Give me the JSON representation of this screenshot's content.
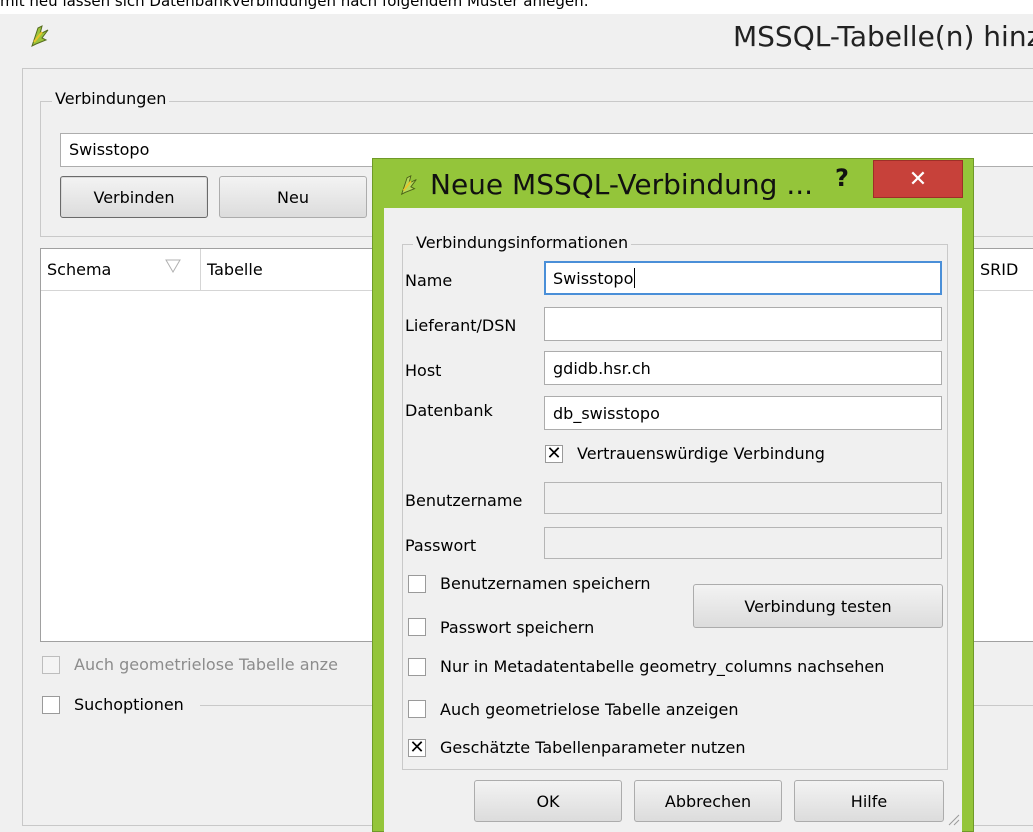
{
  "page_intro": "mit neu lassen sich Datenbankverbindungen nach folgendem Muster anlegen:",
  "main_window": {
    "title": "MSSQL-Tabelle(n) hinz",
    "connections_group_title": "Verbindungen",
    "selected_connection": "Swisstopo",
    "connect_label": "Verbinden",
    "new_label": "Neu",
    "table_headers": {
      "schema": "Schema",
      "table": "Tabelle",
      "srid": "SRID"
    },
    "show_nogeom_label": "Auch geometrielose Tabelle anze",
    "search_options_label": "Suchoptionen"
  },
  "dialog": {
    "title": "Neue MSSQL-Verbindung ...",
    "help_glyph": "?",
    "close_glyph": "✕",
    "group_title": "Verbindungsinformationen",
    "fields": {
      "name_label": "Name",
      "name_value": "Swisstopo",
      "provider_label": "Lieferant/DSN",
      "provider_value": "",
      "host_label": "Host",
      "host_value": "gdidb.hsr.ch",
      "database_label": "Datenbank",
      "database_value": "db_swisstopo",
      "username_label": "Benutzername",
      "username_value": "",
      "password_label": "Passwort",
      "password_value": ""
    },
    "trusted_label": "Vertrauenswürdige Verbindung",
    "trusted_checked": true,
    "save_username_label": "Benutzernamen speichern",
    "save_password_label": "Passwort speichern",
    "test_connection_label": "Verbindung testen",
    "only_metadata_label": "Nur in Metadatentabelle geometry_columns nachsehen",
    "show_nogeom_label": "Auch geometrielose Tabelle anzeigen",
    "estimated_params_label": "Geschätzte Tabellenparameter nutzen",
    "estimated_params_checked": true,
    "check_mark": "✕",
    "ok_label": "OK",
    "cancel_label": "Abbrechen",
    "help_label": "Hilfe"
  },
  "colors": {
    "dialog_frame": "#94c53a",
    "close_button": "#c7413a",
    "focus_border": "#4a8fd8"
  }
}
